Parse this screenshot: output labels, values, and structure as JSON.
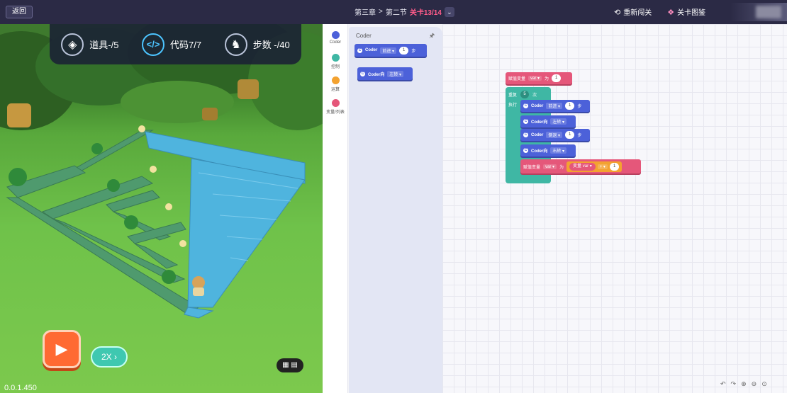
{
  "topbar": {
    "back_label": "返回",
    "breadcrumb_chapter": "第三章",
    "breadcrumb_sep": ">",
    "breadcrumb_section": "第二节",
    "level_label": "关卡13/14",
    "chevron": "⌄",
    "restart_label": "重新闯关",
    "gallery_label": "关卡图鉴"
  },
  "hud": {
    "items_label": "道具-/5",
    "code_label": "代码7/7",
    "steps_label": "步数 -/40"
  },
  "controls": {
    "play_icon": "play-icon",
    "speed_label": "2X ›",
    "version": "0.0.1.450"
  },
  "categories": [
    {
      "label": "Coder",
      "color": "#4c61d9"
    },
    {
      "label": "控制",
      "color": "#3fb7a4"
    },
    {
      "label": "运算",
      "color": "#f3a230"
    },
    {
      "label": "变量/列表",
      "color": "#e5577a"
    }
  ],
  "flyout": {
    "title": "Coder",
    "pin": "🖈",
    "block_move": {
      "prefix": "Coder",
      "dir": "前进 ▾",
      "value": "1",
      "unit": "步"
    },
    "block_turn": {
      "prefix": "Coder向",
      "dir": "左转 ▾"
    }
  },
  "program": {
    "set_var": {
      "label": "赋值变量",
      "var": "var ▾",
      "to": "为",
      "value": "1"
    },
    "repeat": {
      "label": "重复",
      "count": "5",
      "unit": "次",
      "exec": "执行"
    },
    "stmts": [
      {
        "prefix": "Coder",
        "dir": "前进 ▾",
        "value": "1",
        "unit": "步"
      },
      {
        "prefix": "Coder向",
        "dir": "左转 ▾"
      },
      {
        "prefix": "Coder",
        "dir": "倒退 ▾",
        "value": "1",
        "unit": "步"
      },
      {
        "prefix": "Coder向",
        "dir": "右转 ▾"
      }
    ],
    "inner_set": {
      "label": "赋值变量",
      "var": "var ▾",
      "to": "为",
      "var_ref_label": "变量",
      "var_ref": "var ▾",
      "op": "+ ▾",
      "value": "1"
    }
  },
  "zoom_icons": [
    "undo-icon",
    "redo-icon",
    "zoom-in-icon",
    "zoom-out-icon",
    "recenter-icon"
  ]
}
